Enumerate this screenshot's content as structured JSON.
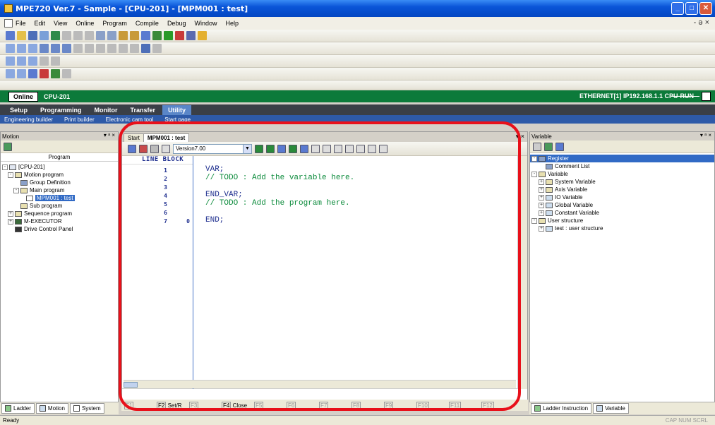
{
  "window": {
    "title": "MPE720 Ver.7 - Sample - [CPU-201] - [MPM001 : test]",
    "controls": [
      "_",
      "□",
      "✕"
    ]
  },
  "menu": {
    "items": [
      "File",
      "Edit",
      "View",
      "Online",
      "Program",
      "Compile",
      "Debug",
      "Window",
      "Help"
    ],
    "mdi_controls": "- ə ×"
  },
  "online_bar": {
    "status": "Online",
    "cpu": "CPU-201",
    "connection": "ETHERNET[1] IP192.168.1.1 CPU-RUN"
  },
  "ribbon": {
    "tabs": [
      "Setup",
      "Programming",
      "Monitor",
      "Transfer",
      "Utility"
    ],
    "active_tab": "Utility",
    "sub_items": [
      "Engineering builder",
      "Print builder",
      "Electronic cam tool",
      "Start page"
    ]
  },
  "left_panel": {
    "title": "Motion",
    "pin": "▾ ᵃ ×",
    "tree_title": "Program",
    "tree": [
      {
        "label": "[CPU-201]",
        "exp": "-"
      },
      {
        "label": "Motion program",
        "exp": "-"
      },
      {
        "label": "Group Definition",
        "exp": ""
      },
      {
        "label": "Main program",
        "exp": "-"
      },
      {
        "label": "MPM001 : test",
        "exp": ""
      },
      {
        "label": "Sub program",
        "exp": ""
      },
      {
        "label": "Sequence program",
        "exp": "+"
      },
      {
        "label": "M-EXECUTOR",
        "exp": "+"
      },
      {
        "label": "Drive Control Panel",
        "exp": ""
      }
    ],
    "bottom_tabs": [
      "Ladder",
      "Motion",
      "System"
    ]
  },
  "editor": {
    "tabs": [
      "Start",
      "MPM001 : test"
    ],
    "active_tab": "MPM001 : test",
    "version": "Version7.00",
    "header": "LINE  BLOCK",
    "lines": [
      {
        "no": "1",
        "block": "",
        "code": "VAR;",
        "type": "kw"
      },
      {
        "no": "2",
        "block": "",
        "code": "// TODO : Add the variable here.",
        "type": "cm"
      },
      {
        "no": "3",
        "block": "",
        "code": "",
        "type": "kw"
      },
      {
        "no": "4",
        "block": "",
        "code": "END_VAR;",
        "type": "kw"
      },
      {
        "no": "5",
        "block": "",
        "code": "// TODO : Add the program here.",
        "type": "cm"
      },
      {
        "no": "6",
        "block": "",
        "code": "",
        "type": "kw"
      },
      {
        "no": "7",
        "block": "0",
        "code": "END;",
        "type": "kw"
      }
    ]
  },
  "function_keys": [
    {
      "key": "F1",
      "label": "",
      "enabled": false
    },
    {
      "key": "F2",
      "label": "Set/R",
      "enabled": true
    },
    {
      "key": "F3",
      "label": "",
      "enabled": false
    },
    {
      "key": "F4",
      "label": "Close",
      "enabled": true
    },
    {
      "key": "F5",
      "label": "",
      "enabled": false
    },
    {
      "key": "F6",
      "label": "",
      "enabled": false
    },
    {
      "key": "F7",
      "label": "",
      "enabled": false
    },
    {
      "key": "F8",
      "label": "",
      "enabled": false
    },
    {
      "key": "F9",
      "label": "",
      "enabled": false
    },
    {
      "key": "F10",
      "label": "",
      "enabled": false
    },
    {
      "key": "F11",
      "label": "",
      "enabled": false
    },
    {
      "key": "F12",
      "label": "",
      "enabled": false
    }
  ],
  "right_panel": {
    "title": "Variable",
    "pin": "▾ ᵃ ×",
    "tree": [
      {
        "label": "Register",
        "exp": "-",
        "depth": 0
      },
      {
        "label": "Comment List",
        "exp": "",
        "depth": 2
      },
      {
        "label": "Variable",
        "exp": "-",
        "depth": 0
      },
      {
        "label": "System Variable",
        "exp": "+",
        "depth": 1
      },
      {
        "label": "Axis Variable",
        "exp": "+",
        "depth": 1
      },
      {
        "label": "IO Variable",
        "exp": "+",
        "depth": 1
      },
      {
        "label": "Global Variable",
        "exp": "+",
        "depth": 1
      },
      {
        "label": "Constant Variable",
        "exp": "+",
        "depth": 1
      },
      {
        "label": "User structure",
        "exp": "-",
        "depth": 0
      },
      {
        "label": "test : user structure",
        "exp": "+",
        "depth": 1
      }
    ],
    "bottom_tabs": [
      "Ladder Instruction",
      "Variable"
    ]
  },
  "statusbar": {
    "text": "Ready",
    "indicators": "CAP NUM SCRL"
  },
  "colors": {
    "titlebar": "#0a55d8",
    "online": "#0c7a3a",
    "highlight": "#e8101a",
    "keyword": "#1f2f8f",
    "comment": "#0a8a3a"
  }
}
